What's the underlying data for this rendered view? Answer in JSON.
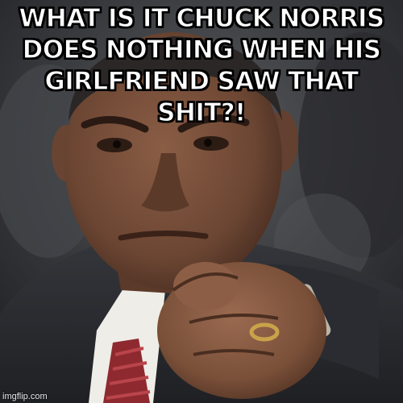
{
  "meme": {
    "caption": "WHAT IS IT CHUCK NORRIS DOES NOTHING WHEN HIS GIRLFRIEND SAW THAT SHIT?!",
    "watermark": "imgflip.com"
  },
  "colors": {
    "caption_fill": "#ffffff",
    "caption_outline": "#000000",
    "suit": "#2b2d31",
    "shirt": "#f2f0ec",
    "tie": "#8e2a2f",
    "skin": "#6f4a36",
    "background": "#3a3b3e"
  }
}
